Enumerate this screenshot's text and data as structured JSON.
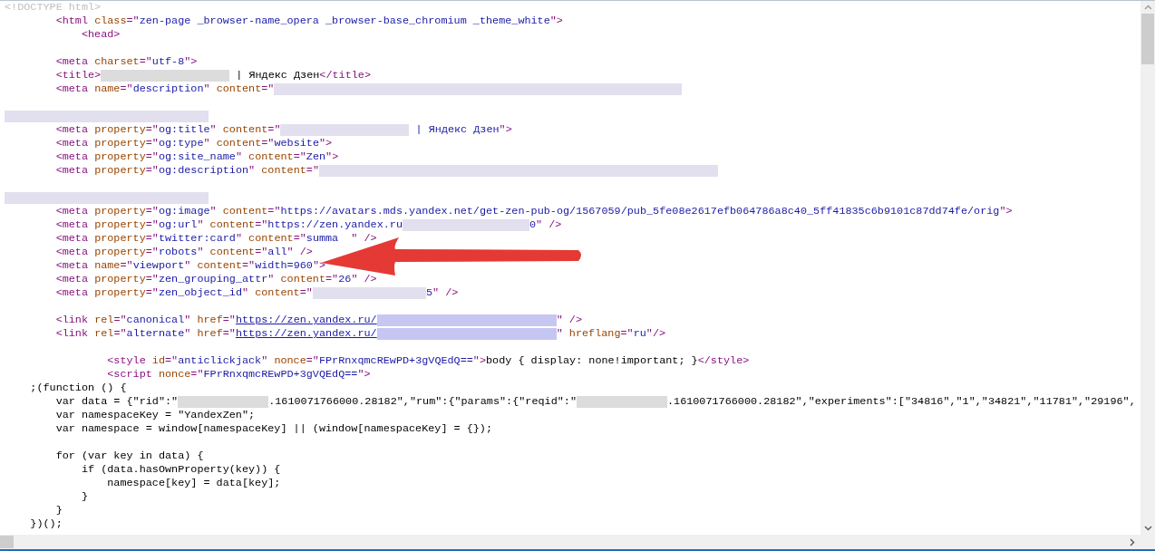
{
  "source_lines": [
    {
      "kind": "code",
      "segments": [
        {
          "kind": "doctype",
          "text": "<!DOCTYPE html>"
        }
      ]
    },
    {
      "kind": "code",
      "segments": [
        {
          "kind": "tag",
          "text": "        <html "
        },
        {
          "kind": "attr",
          "text": "class"
        },
        {
          "kind": "tag",
          "text": "=\""
        },
        {
          "kind": "value",
          "text": "zen-page _browser-name_opera _browser-base_chromium _theme_white"
        },
        {
          "kind": "tag",
          "text": "\">"
        }
      ]
    },
    {
      "kind": "code",
      "segments": [
        {
          "kind": "tag",
          "text": "            <head>"
        }
      ]
    },
    {
      "kind": "blank"
    },
    {
      "kind": "code",
      "segments": [
        {
          "kind": "tag",
          "text": "        <meta "
        },
        {
          "kind": "attr",
          "text": "charset"
        },
        {
          "kind": "tag",
          "text": "=\""
        },
        {
          "kind": "value",
          "text": "utf-8"
        },
        {
          "kind": "tag",
          "text": "\">"
        }
      ]
    },
    {
      "kind": "code",
      "segments": [
        {
          "kind": "tag",
          "text": "        <title>"
        },
        {
          "kind": "redacted-gray"
        },
        {
          "kind": "text",
          "text": " | Яндекс Дзен"
        },
        {
          "kind": "tag",
          "text": "</title>"
        }
      ]
    },
    {
      "kind": "code",
      "segments": [
        {
          "kind": "tag",
          "text": "        <meta "
        },
        {
          "kind": "attr",
          "text": "name"
        },
        {
          "kind": "tag",
          "text": "=\""
        },
        {
          "kind": "value",
          "text": "description"
        },
        {
          "kind": "tag",
          "text": "\" "
        },
        {
          "kind": "attr",
          "text": "content"
        },
        {
          "kind": "tag",
          "text": "=\""
        },
        {
          "kind": "redacted"
        }
      ]
    },
    {
      "kind": "blank"
    },
    {
      "kind": "code",
      "segments": [
        {
          "kind": "redacted"
        }
      ]
    },
    {
      "kind": "code",
      "segments": [
        {
          "kind": "tag",
          "text": "        <meta "
        },
        {
          "kind": "attr",
          "text": "property"
        },
        {
          "kind": "tag",
          "text": "=\""
        },
        {
          "kind": "value",
          "text": "og:title"
        },
        {
          "kind": "tag",
          "text": "\" "
        },
        {
          "kind": "attr",
          "text": "content"
        },
        {
          "kind": "tag",
          "text": "=\""
        },
        {
          "kind": "redacted"
        },
        {
          "kind": "value",
          "text": " | Яндекс Дзен"
        },
        {
          "kind": "tag",
          "text": "\">"
        }
      ]
    },
    {
      "kind": "code",
      "segments": [
        {
          "kind": "tag",
          "text": "        <meta "
        },
        {
          "kind": "attr",
          "text": "property"
        },
        {
          "kind": "tag",
          "text": "=\""
        },
        {
          "kind": "value",
          "text": "og:type"
        },
        {
          "kind": "tag",
          "text": "\" "
        },
        {
          "kind": "attr",
          "text": "content"
        },
        {
          "kind": "tag",
          "text": "=\""
        },
        {
          "kind": "value",
          "text": "website"
        },
        {
          "kind": "tag",
          "text": "\">"
        }
      ]
    },
    {
      "kind": "code",
      "segments": [
        {
          "kind": "tag",
          "text": "        <meta "
        },
        {
          "kind": "attr",
          "text": "property"
        },
        {
          "kind": "tag",
          "text": "=\""
        },
        {
          "kind": "value",
          "text": "og:site_name"
        },
        {
          "kind": "tag",
          "text": "\" "
        },
        {
          "kind": "attr",
          "text": "content"
        },
        {
          "kind": "tag",
          "text": "=\""
        },
        {
          "kind": "value",
          "text": "Zen"
        },
        {
          "kind": "tag",
          "text": "\">"
        }
      ]
    },
    {
      "kind": "code",
      "segments": [
        {
          "kind": "tag",
          "text": "        <meta "
        },
        {
          "kind": "attr",
          "text": "property"
        },
        {
          "kind": "tag",
          "text": "=\""
        },
        {
          "kind": "value",
          "text": "og:description"
        },
        {
          "kind": "tag",
          "text": "\" "
        },
        {
          "kind": "attr",
          "text": "content"
        },
        {
          "kind": "tag",
          "text": "=\""
        },
        {
          "kind": "redacted"
        }
      ]
    },
    {
      "kind": "blank"
    },
    {
      "kind": "code",
      "segments": [
        {
          "kind": "redacted"
        }
      ]
    },
    {
      "kind": "code",
      "segments": [
        {
          "kind": "tag",
          "text": "        <meta "
        },
        {
          "kind": "attr",
          "text": "property"
        },
        {
          "kind": "tag",
          "text": "=\""
        },
        {
          "kind": "value",
          "text": "og:image"
        },
        {
          "kind": "tag",
          "text": "\" "
        },
        {
          "kind": "attr",
          "text": "content"
        },
        {
          "kind": "tag",
          "text": "=\""
        },
        {
          "kind": "value",
          "text": "https://avatars.mds.yandex.net/get-zen-pub-og/1567059/pub_5fe08e2617efb064786a8c40_5ff41835c6b9101c87dd74fe/orig"
        },
        {
          "kind": "tag",
          "text": "\">"
        }
      ]
    },
    {
      "kind": "code",
      "segments": [
        {
          "kind": "tag",
          "text": "        <meta "
        },
        {
          "kind": "attr",
          "text": "property"
        },
        {
          "kind": "tag",
          "text": "=\""
        },
        {
          "kind": "value",
          "text": "og:url"
        },
        {
          "kind": "tag",
          "text": "\" "
        },
        {
          "kind": "attr",
          "text": "content"
        },
        {
          "kind": "tag",
          "text": "=\""
        },
        {
          "kind": "value",
          "text": "https://zen.yandex.ru"
        },
        {
          "kind": "redacted"
        },
        {
          "kind": "value",
          "text": "0"
        },
        {
          "kind": "tag",
          "text": "\" />"
        }
      ]
    },
    {
      "kind": "code",
      "segments": [
        {
          "kind": "tag",
          "text": "        <meta "
        },
        {
          "kind": "attr",
          "text": "property"
        },
        {
          "kind": "tag",
          "text": "=\""
        },
        {
          "kind": "value",
          "text": "twitter:card"
        },
        {
          "kind": "tag",
          "text": "\" "
        },
        {
          "kind": "attr",
          "text": "content"
        },
        {
          "kind": "tag",
          "text": "=\""
        },
        {
          "kind": "value",
          "text": "summa"
        },
        {
          "kind": "tag",
          "text": "  \" />"
        }
      ]
    },
    {
      "kind": "code",
      "segments": [
        {
          "kind": "tag",
          "text": "        <meta "
        },
        {
          "kind": "attr",
          "text": "property"
        },
        {
          "kind": "tag",
          "text": "=\""
        },
        {
          "kind": "value",
          "text": "robots"
        },
        {
          "kind": "tag",
          "text": "\" "
        },
        {
          "kind": "attr",
          "text": "content"
        },
        {
          "kind": "tag",
          "text": "=\""
        },
        {
          "kind": "value",
          "text": "all"
        },
        {
          "kind": "tag",
          "text": "\" />"
        }
      ]
    },
    {
      "kind": "code",
      "segments": [
        {
          "kind": "tag",
          "text": "        <meta "
        },
        {
          "kind": "attr",
          "text": "name"
        },
        {
          "kind": "tag",
          "text": "=\""
        },
        {
          "kind": "value",
          "text": "viewport"
        },
        {
          "kind": "tag",
          "text": "\" "
        },
        {
          "kind": "attr",
          "text": "content"
        },
        {
          "kind": "tag",
          "text": "=\""
        },
        {
          "kind": "value",
          "text": "width=960"
        },
        {
          "kind": "tag",
          "text": "\">"
        }
      ]
    },
    {
      "kind": "code",
      "segments": [
        {
          "kind": "tag",
          "text": "        <meta "
        },
        {
          "kind": "attr",
          "text": "property"
        },
        {
          "kind": "tag",
          "text": "=\""
        },
        {
          "kind": "value",
          "text": "zen_grouping_attr"
        },
        {
          "kind": "tag",
          "text": "\" "
        },
        {
          "kind": "attr",
          "text": "content"
        },
        {
          "kind": "tag",
          "text": "=\""
        },
        {
          "kind": "value",
          "text": "26"
        },
        {
          "kind": "tag",
          "text": "\" />"
        }
      ]
    },
    {
      "kind": "code",
      "segments": [
        {
          "kind": "tag",
          "text": "        <meta "
        },
        {
          "kind": "attr",
          "text": "property"
        },
        {
          "kind": "tag",
          "text": "=\""
        },
        {
          "kind": "value",
          "text": "zen_object_id"
        },
        {
          "kind": "tag",
          "text": "\" "
        },
        {
          "kind": "attr",
          "text": "content"
        },
        {
          "kind": "tag",
          "text": "=\""
        },
        {
          "kind": "redacted"
        },
        {
          "kind": "value",
          "text": "5"
        },
        {
          "kind": "tag",
          "text": "\" />"
        }
      ]
    },
    {
      "kind": "blank"
    },
    {
      "kind": "code",
      "segments": [
        {
          "kind": "tag",
          "text": "        <link "
        },
        {
          "kind": "attr",
          "text": "rel"
        },
        {
          "kind": "tag",
          "text": "=\""
        },
        {
          "kind": "value",
          "text": "canonical"
        },
        {
          "kind": "tag",
          "text": "\" "
        },
        {
          "kind": "attr",
          "text": "href"
        },
        {
          "kind": "tag",
          "text": "=\""
        },
        {
          "kind": "link",
          "text": "https://zen.yandex.ru/"
        },
        {
          "kind": "redacted-link"
        },
        {
          "kind": "tag",
          "text": "\" />"
        }
      ]
    },
    {
      "kind": "code",
      "segments": [
        {
          "kind": "tag",
          "text": "        <link "
        },
        {
          "kind": "attr",
          "text": "rel"
        },
        {
          "kind": "tag",
          "text": "=\""
        },
        {
          "kind": "value",
          "text": "alternate"
        },
        {
          "kind": "tag",
          "text": "\" "
        },
        {
          "kind": "attr",
          "text": "href"
        },
        {
          "kind": "tag",
          "text": "=\""
        },
        {
          "kind": "link",
          "text": "https://zen.yandex.ru/"
        },
        {
          "kind": "redacted-link"
        },
        {
          "kind": "tag",
          "text": "\" "
        },
        {
          "kind": "attr",
          "text": "hreflang"
        },
        {
          "kind": "tag",
          "text": "=\""
        },
        {
          "kind": "value",
          "text": "ru"
        },
        {
          "kind": "tag",
          "text": "\"/>"
        }
      ]
    },
    {
      "kind": "blank"
    },
    {
      "kind": "code",
      "segments": [
        {
          "kind": "tag",
          "text": "                <style "
        },
        {
          "kind": "attr",
          "text": "id"
        },
        {
          "kind": "tag",
          "text": "=\""
        },
        {
          "kind": "value",
          "text": "anticlickjack"
        },
        {
          "kind": "tag",
          "text": "\" "
        },
        {
          "kind": "attr",
          "text": "nonce"
        },
        {
          "kind": "tag",
          "text": "=\""
        },
        {
          "kind": "value",
          "text": "FPrRnxqmcREwPD+3gVQEdQ=="
        },
        {
          "kind": "tag",
          "text": "\">"
        },
        {
          "kind": "text",
          "text": "body { display: none!important; }"
        },
        {
          "kind": "tag",
          "text": "</style>"
        }
      ]
    },
    {
      "kind": "code",
      "segments": [
        {
          "kind": "tag",
          "text": "                <script "
        },
        {
          "kind": "attr",
          "text": "nonce"
        },
        {
          "kind": "tag",
          "text": "=\""
        },
        {
          "kind": "value",
          "text": "FPrRnxqmcREwPD+3gVQEdQ=="
        },
        {
          "kind": "tag",
          "text": "\">"
        }
      ]
    },
    {
      "kind": "code",
      "segments": [
        {
          "kind": "text",
          "text": "    ;(function () {"
        }
      ]
    },
    {
      "kind": "code",
      "segments": [
        {
          "kind": "text",
          "text": "        var data = {\"rid\":\""
        },
        {
          "kind": "redacted-gray"
        },
        {
          "kind": "text",
          "text": ".1610071766000.28182\",\"rum\":{\"params\":{\"reqid\":\""
        },
        {
          "kind": "redacted-gray"
        },
        {
          "kind": "text",
          "text": ".1610071766000.28182\",\"experiments\":[\"34816\",\"1\",\"34821\",\"11781\",\"29196\","
        }
      ]
    },
    {
      "kind": "code",
      "segments": [
        {
          "kind": "text",
          "text": "        var namespaceKey = \"YandexZen\";"
        }
      ]
    },
    {
      "kind": "code",
      "segments": [
        {
          "kind": "text",
          "text": "        var namespace = window[namespaceKey] || (window[namespaceKey] = {});"
        }
      ]
    },
    {
      "kind": "blank"
    },
    {
      "kind": "code",
      "segments": [
        {
          "kind": "text",
          "text": "        for (var key in data) {"
        }
      ]
    },
    {
      "kind": "code",
      "segments": [
        {
          "kind": "text",
          "text": "            if (data.hasOwnProperty(key)) {"
        }
      ]
    },
    {
      "kind": "code",
      "segments": [
        {
          "kind": "text",
          "text": "                namespace[key] = data[key];"
        }
      ]
    },
    {
      "kind": "code",
      "segments": [
        {
          "kind": "text",
          "text": "            }"
        }
      ]
    },
    {
      "kind": "code",
      "segments": [
        {
          "kind": "text",
          "text": "        }"
        }
      ]
    },
    {
      "kind": "code",
      "segments": [
        {
          "kind": "text",
          "text": "    })();"
        }
      ]
    }
  ]
}
